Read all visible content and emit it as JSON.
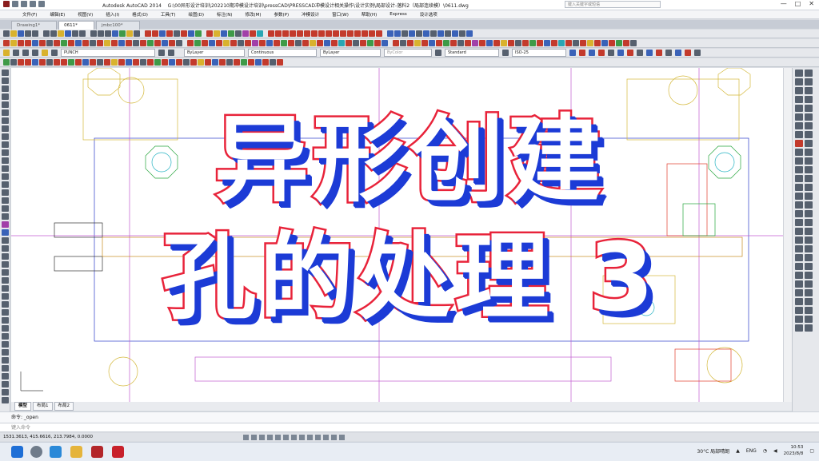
{
  "window": {
    "app_name": "Autodesk AutoCAD 2014",
    "file_path": "G:\\00异形设计培训\\202210期冲模设计培训\\pressCAD\\PRESSCAD冲模设计相关操作\\设计实例\\局部设计-落料2（局部连续模）\\0611.dwg",
    "search_placeholder": "键入关键字或短语",
    "controls": [
      "—",
      "□",
      "✕"
    ]
  },
  "menu": [
    "文件(F)",
    "编辑(E)",
    "视图(V)",
    "插入(I)",
    "格式(O)",
    "工具(T)",
    "绘图(D)",
    "标注(N)",
    "修改(M)",
    "参数(P)",
    "冲模设计",
    "窗口(W)",
    "帮助(H)",
    "Express",
    "设计选项"
  ],
  "doc_tabs": [
    {
      "label": "Drawing1*",
      "active": false
    },
    {
      "label": "0611*",
      "active": true
    },
    {
      "label": "jmbc100*",
      "active": false
    }
  ],
  "properties_bar": {
    "layer": "PUNCH",
    "color": "ByLayer",
    "linetype": "Continuous",
    "lineweight": "ByLayer",
    "plotstyle": "ByColor",
    "text_style": "Standard",
    "dim_style": "ISO-25"
  },
  "layout_tabs": [
    {
      "label": "模型",
      "active": true
    },
    {
      "label": "布局1",
      "active": false
    },
    {
      "label": "布局2",
      "active": false
    }
  ],
  "command": {
    "history": "命令: _open",
    "prompt": "键入命令"
  },
  "status": {
    "coords": "1531.3613, 415.6616, 213.7984, 0.0000"
  },
  "overlay": {
    "line1": "异形创建",
    "line2": "孔的处理 3"
  },
  "taskbar": {
    "weather": "30°C  局部晴朗",
    "lang": "ENG",
    "time": "10:53",
    "date": "2023/8/8"
  },
  "colors": {
    "overlay_stroke": "#e8233a",
    "overlay_shadow": "#1c3bd6",
    "overlay_fill": "#ffffff"
  }
}
